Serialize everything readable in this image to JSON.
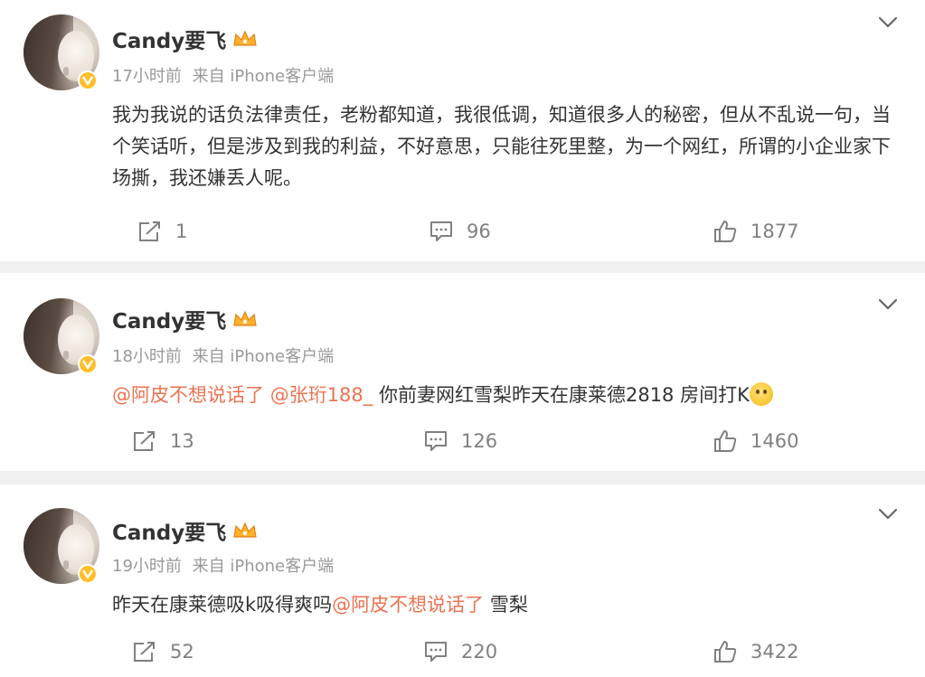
{
  "posts": [
    {
      "author": "Candy要飞",
      "time": "17小时前",
      "source": "来自 iPhone客户端",
      "text": "我为我说的话负法律责任，老粉都知道，我很低调，知道很多人的秘密，但从不乱说一句，当个笑话听，但是涉及到我的利益，不好意思，只能往死里整，为一个网红，所谓的小企业家下场撕，我还嫌丢人呢。",
      "reposts": "1",
      "comments": "96",
      "likes": "1877"
    },
    {
      "author": "Candy要飞",
      "time": "18小时前",
      "source": "来自 iPhone客户端",
      "mention1": "@阿皮不想说话了",
      "mention2": "@张珩188_",
      "text_after": "你前妻网红雪梨昨天在康莱德2818 房间打K",
      "reposts": "13",
      "comments": "126",
      "likes": "1460"
    },
    {
      "author": "Candy要飞",
      "time": "19小时前",
      "source": "来自 iPhone客户端",
      "text_before": "昨天在康莱德吸k吸得爽吗",
      "mention1": "@阿皮不想说话了",
      "text_after": " 雪梨",
      "reposts": "52",
      "comments": "220",
      "likes": "3422"
    }
  ],
  "icons": {
    "repost": "repost-icon",
    "comment": "comment-icon",
    "like": "like-icon",
    "more": "chevron-down-icon",
    "verified": "verified-badge-icon",
    "member": "crown-icon",
    "emoji": "emoji-icon"
  },
  "colors": {
    "mention": "#eb7350",
    "verified": "#ffbf2b",
    "muted": "#999999"
  }
}
